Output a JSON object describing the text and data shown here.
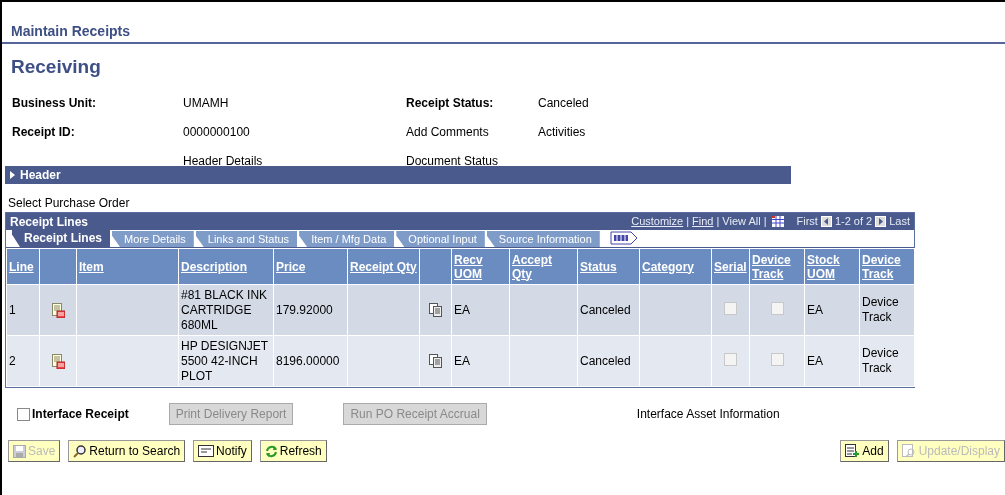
{
  "breadcrumb": "Maintain Receipts",
  "page_title": "Receiving",
  "fields": [
    {
      "label": "Business Unit:",
      "value": "UMAMH"
    },
    {
      "label": "Receipt Status:",
      "value": "Canceled"
    },
    {
      "label": "Receipt ID:",
      "value": "0000000100"
    },
    {
      "link": "Add Comments",
      "link2": "Activities"
    },
    {
      "link": "Header Details"
    },
    {
      "link": "Document Status"
    }
  ],
  "header_section": {
    "label": "Header",
    "expanded": false
  },
  "select_po": "Select Purchase Order",
  "grid": {
    "title": "Receipt Lines",
    "nav": [
      {
        "kind": "link",
        "text": "Customize"
      },
      {
        "kind": "sep",
        "text": "|"
      },
      {
        "kind": "link",
        "text": "Find"
      },
      {
        "kind": "sep",
        "text": "|"
      },
      {
        "kind": "plain",
        "text": "View All"
      },
      {
        "kind": "sep",
        "text": "|"
      },
      {
        "kind": "grid_icon"
      },
      {
        "kind": "plain",
        "text": "First"
      },
      {
        "kind": "prev_icon"
      },
      {
        "kind": "plain",
        "text": "1-2 of 2"
      },
      {
        "kind": "next_icon"
      },
      {
        "kind": "plain",
        "text": "Last"
      }
    ],
    "tabs": [
      {
        "label": "Receipt Lines",
        "selected": true
      },
      {
        "label": "More Details",
        "selected": false
      },
      {
        "label": "Links and Status",
        "selected": false
      },
      {
        "label": "Item / Mfg Data",
        "selected": false
      },
      {
        "label": "Optional Input",
        "selected": false
      },
      {
        "label": "Source Information",
        "selected": false
      }
    ],
    "columns": [
      {
        "kind": "text",
        "label": "Line"
      },
      {
        "kind": "blank"
      },
      {
        "kind": "text",
        "label": "Item"
      },
      {
        "kind": "text",
        "label": "Description"
      },
      {
        "kind": "text",
        "label": "Price"
      },
      {
        "kind": "text",
        "label": "Receipt Qty"
      },
      {
        "kind": "blank"
      },
      {
        "kind": "text",
        "label": "Recv UOM"
      },
      {
        "kind": "text",
        "label": "Accept Qty"
      },
      {
        "kind": "text",
        "label": "Status"
      },
      {
        "kind": "text",
        "label": "Category"
      },
      {
        "kind": "text",
        "label": "Serial"
      },
      {
        "kind": "text",
        "label": "Device Track"
      },
      {
        "kind": "text",
        "label": "Stock UOM"
      },
      {
        "kind": "text",
        "label": "Device Track"
      }
    ],
    "rows": [
      {
        "cells": [
          {
            "kind": "text",
            "text": "1"
          },
          {
            "kind": "doc_icon"
          },
          {
            "kind": "empty"
          },
          {
            "kind": "text",
            "text": "#81 BLACK INK CARTRIDGE 680ML"
          },
          {
            "kind": "text",
            "text": "179.92000"
          },
          {
            "kind": "empty"
          },
          {
            "kind": "copy_icon"
          },
          {
            "kind": "text",
            "text": "EA"
          },
          {
            "kind": "empty"
          },
          {
            "kind": "text",
            "text": "Canceled"
          },
          {
            "kind": "empty"
          },
          {
            "kind": "checkbox",
            "checked": false,
            "disabled": true
          },
          {
            "kind": "checkbox",
            "checked": false,
            "disabled": true
          },
          {
            "kind": "text",
            "text": "EA"
          },
          {
            "kind": "text",
            "text": "Device Track"
          }
        ]
      },
      {
        "cells": [
          {
            "kind": "text",
            "text": "2"
          },
          {
            "kind": "doc_icon"
          },
          {
            "kind": "empty"
          },
          {
            "kind": "text",
            "text": "HP DESIGNJET 5500 42-INCH PLOT"
          },
          {
            "kind": "text",
            "text": "8196.00000"
          },
          {
            "kind": "empty"
          },
          {
            "kind": "copy_icon"
          },
          {
            "kind": "text",
            "text": "EA"
          },
          {
            "kind": "empty"
          },
          {
            "kind": "text",
            "text": "Canceled"
          },
          {
            "kind": "empty"
          },
          {
            "kind": "checkbox",
            "checked": false,
            "disabled": true
          },
          {
            "kind": "checkbox",
            "checked": false,
            "disabled": true
          },
          {
            "kind": "text",
            "text": "EA"
          },
          {
            "kind": "text",
            "text": "Device Track"
          }
        ]
      }
    ]
  },
  "interface_receipt": {
    "label": "Interface Receipt",
    "checked": false
  },
  "action_buttons": [
    {
      "label": "Print Delivery Report",
      "disabled": true
    },
    {
      "label": "Run PO Receipt Accrual",
      "disabled": true
    }
  ],
  "asset_link": "Interface Asset Information",
  "toolbar_left": [
    {
      "kind": "save",
      "label": "Save",
      "disabled": true
    },
    {
      "kind": "search",
      "label": "Return to Search",
      "disabled": false
    },
    {
      "kind": "notify",
      "label": "Notify",
      "disabled": false
    },
    {
      "kind": "refresh",
      "label": "Refresh",
      "disabled": false
    }
  ],
  "toolbar_right": [
    {
      "kind": "add",
      "label": "Add",
      "disabled": false
    },
    {
      "kind": "update",
      "label": "Update/Display",
      "disabled": true
    }
  ]
}
